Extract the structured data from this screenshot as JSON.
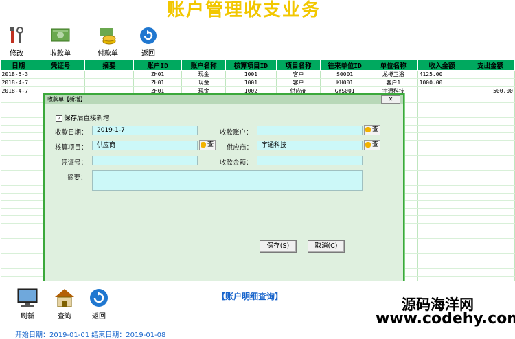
{
  "banner": {
    "title": "账户管理收支业务"
  },
  "toolbar": [
    {
      "label": "修改",
      "icon": "tools-icon"
    },
    {
      "label": "收款单",
      "icon": "cash-bill-icon"
    },
    {
      "label": "付款单",
      "icon": "coins-icon"
    },
    {
      "label": "返回",
      "icon": "refresh-back-icon"
    }
  ],
  "grid": {
    "columns": [
      "日期",
      "凭证号",
      "摘要",
      "账户ID",
      "账户名称",
      "核算项目ID",
      "项目名称",
      "往来单位ID",
      "单位名称",
      "收入金额",
      "支出金额"
    ],
    "rows": [
      [
        "2018-5-3",
        "",
        "",
        "ZH01",
        "现金",
        "1001",
        "客户",
        "S0001",
        "龙樽卫浴",
        "4125.00",
        ""
      ],
      [
        "2018-4-7",
        "",
        "",
        "ZH01",
        "现金",
        "1001",
        "客户",
        "KH001",
        "客户1",
        "1000.00",
        ""
      ],
      [
        "2018-4-7",
        "",
        "",
        "ZH01",
        "现金",
        "1002",
        "供应商",
        "GYS001",
        "宇通科技",
        "",
        "500.00"
      ]
    ]
  },
  "dialog": {
    "title": "收款单【新增】",
    "close_label": "✕",
    "save_new_label": "保存后直接新增",
    "date_label": "收款日期：",
    "date_value": "2019-1-7",
    "account_label": "收款账户：",
    "account_value": "",
    "project_label": "核算项目：",
    "project_value": "供应商",
    "supplier_label": "供应商：",
    "supplier_value": "宇通科技",
    "voucher_label": "凭证号：",
    "voucher_value": "",
    "amount_label": "收款金额：",
    "amount_value": "",
    "memo_label": "摘要：",
    "memo_value": "",
    "lookup_label": "查",
    "save_label": "保存(S)",
    "cancel_label": "取消(C)"
  },
  "bottom": {
    "buttons": [
      {
        "label": "刷新",
        "icon": "monitor-icon"
      },
      {
        "label": "查询",
        "icon": "house-icon"
      },
      {
        "label": "返回",
        "icon": "refresh-back-icon"
      }
    ],
    "query_title": "【账户明细查询】",
    "footer_text": "开始日期：2019-01-01  结束日期：2019-01-08"
  },
  "watermark": {
    "line1": "源码海洋网",
    "line2": "www.codehy.com"
  }
}
